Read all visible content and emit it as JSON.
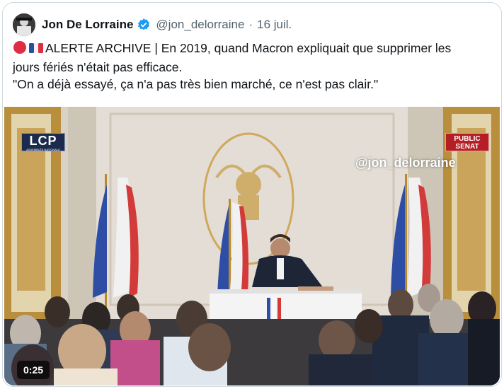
{
  "tweet": {
    "author_name": "Jon De Lorraine",
    "handle": "@jon_delorraine",
    "separator": "·",
    "date": "16 juil.",
    "verified_color": "#1d9bf0",
    "emoji": [
      "red-circle",
      "france-flag"
    ],
    "text_line1": "ALERTE ARCHIVE | En 2019, quand Macron expliquait que supprimer les",
    "text_line2": "jours fériés n'était pas efficace.",
    "text_line3": "\"On a déjà essayé, ça n'a pas très bien marché, ce n'est pas clair.\""
  },
  "video": {
    "duration": "0:25",
    "watermark": "@jon_delorraine",
    "logo_left": "LCP",
    "logo_left_sub": "ASSEMBLÉE NATIONALE",
    "logo_right_line1": "PUBLIC",
    "logo_right_line2": "SENAT"
  }
}
